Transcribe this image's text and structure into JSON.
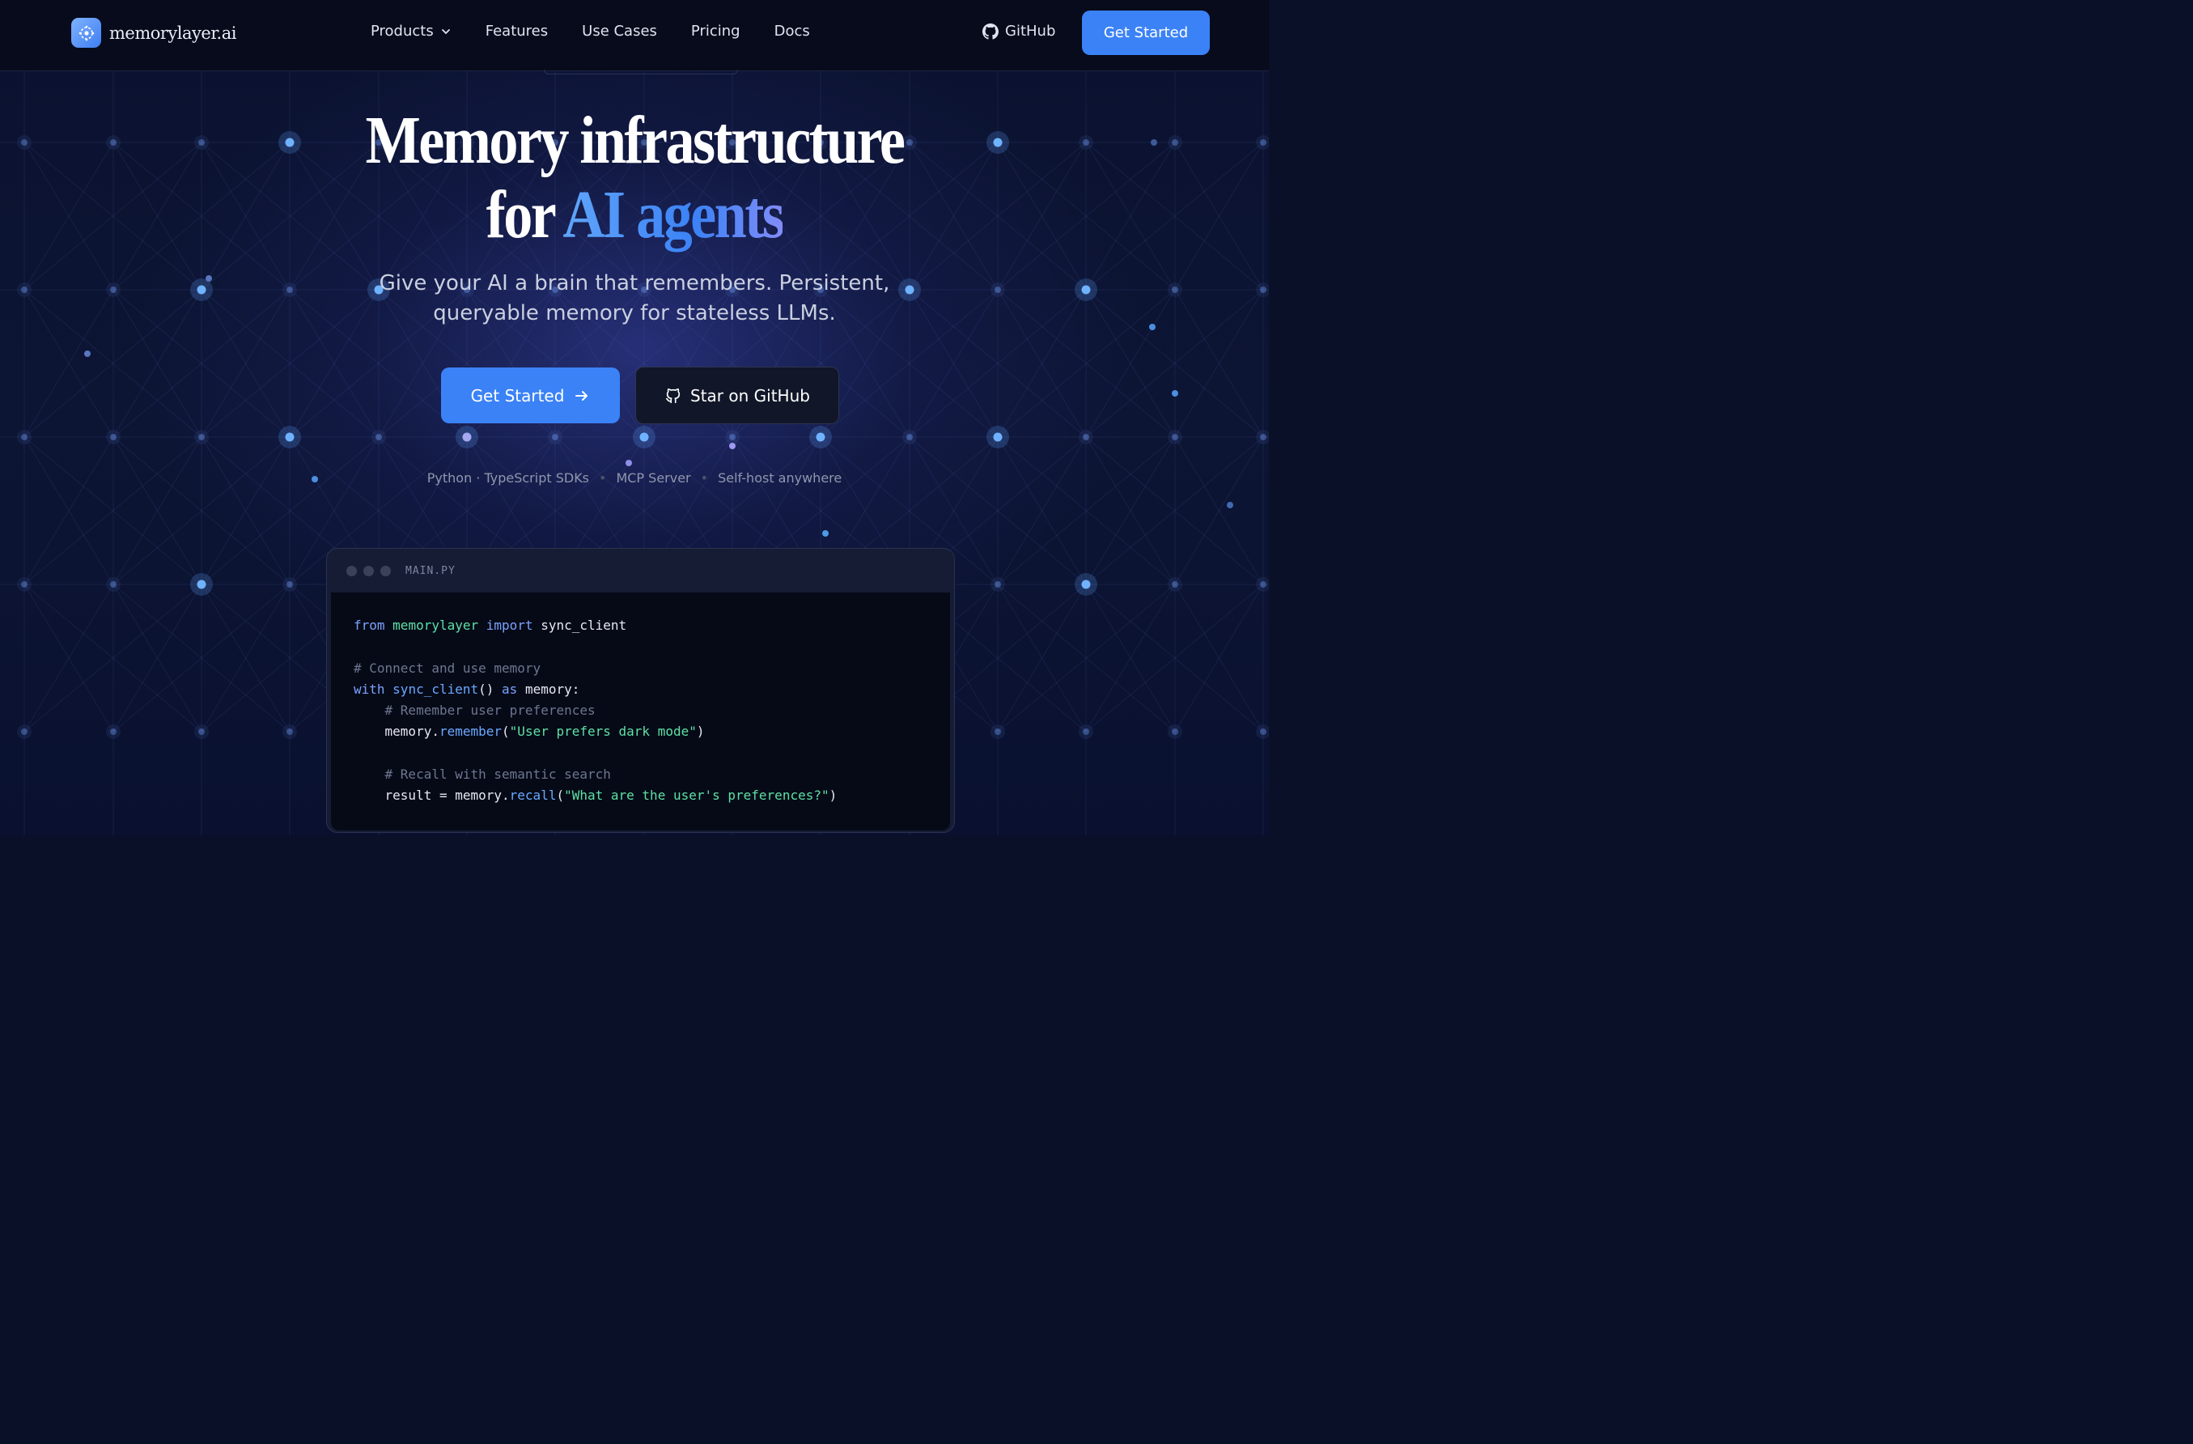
{
  "nav": {
    "brand": "memorylayer.ai",
    "menu": [
      {
        "label": "Products",
        "has_dropdown": true
      },
      {
        "label": "Features"
      },
      {
        "label": "Use Cases"
      },
      {
        "label": "Pricing"
      },
      {
        "label": "Docs"
      }
    ],
    "github_label": "GitHub",
    "cta_label": "Get Started"
  },
  "hero": {
    "title_line1": "Memory infrastructure",
    "title_prefix": "for",
    "title_accent": "AI agents",
    "subtitle_line1": "Give your AI a brain that remembers. Persistent,",
    "subtitle_line2": "queryable memory for stateless LLMs.",
    "primary_cta": "Get Started",
    "secondary_cta": "Star on GitHub",
    "meta": [
      "Python · TypeScript SDKs",
      "MCP Server",
      "Self-host anywhere"
    ]
  },
  "code": {
    "filename": "MAIN.PY",
    "lines": [
      [
        {
          "t": "from",
          "c": "kw"
        },
        {
          "t": " "
        },
        {
          "t": "memorylayer",
          "c": "mod"
        },
        {
          "t": " "
        },
        {
          "t": "import",
          "c": "kw"
        },
        {
          "t": " sync_client"
        }
      ],
      [],
      [
        {
          "t": "# Connect and use memory",
          "c": "cm"
        }
      ],
      [
        {
          "t": "with",
          "c": "kw"
        },
        {
          "t": " "
        },
        {
          "t": "sync_client",
          "c": "fn"
        },
        {
          "t": "() "
        },
        {
          "t": "as",
          "c": "kw"
        },
        {
          "t": " memory:"
        }
      ],
      [
        {
          "t": "    "
        },
        {
          "t": "# Remember user preferences",
          "c": "cm"
        }
      ],
      [
        {
          "t": "    memory."
        },
        {
          "t": "remember",
          "c": "fn"
        },
        {
          "t": "("
        },
        {
          "t": "\"User prefers dark mode\"",
          "c": "str"
        },
        {
          "t": ")"
        }
      ],
      [],
      [
        {
          "t": "    "
        },
        {
          "t": "# Recall with semantic search",
          "c": "cm"
        }
      ],
      [
        {
          "t": "    result = memory."
        },
        {
          "t": "recall",
          "c": "fn"
        },
        {
          "t": "("
        },
        {
          "t": "\"What are the user's preferences?\"",
          "c": "str"
        },
        {
          "t": ")"
        }
      ]
    ]
  },
  "colors": {
    "background": "#0a1028",
    "accent": "#3b82f6",
    "nav_bg": "#070b1b",
    "code_bg": "#060a17"
  }
}
